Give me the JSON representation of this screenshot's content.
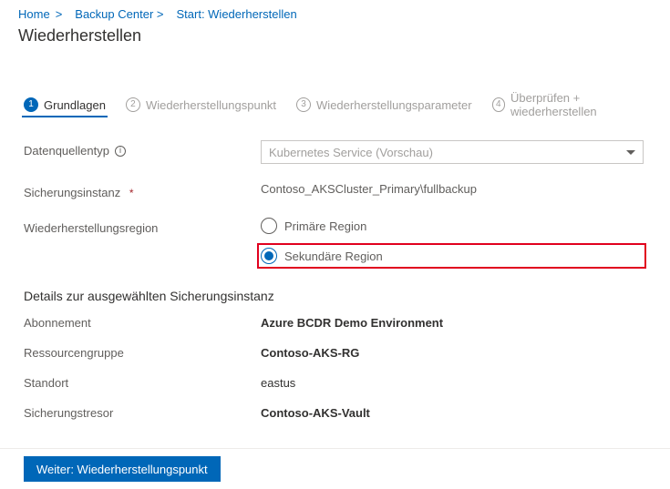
{
  "breadcrumb": {
    "home": "Home",
    "sep1": ">",
    "center": "Backup Center >",
    "start": "Start: Wiederherstellen"
  },
  "title": "Wiederherstellen",
  "wizard": {
    "step1": "Grundlagen",
    "step2": "Wiederherstellungspunkt",
    "step3": "Wiederherstellungsparameter",
    "step4": "Überprüfen + wiederherstellen"
  },
  "form": {
    "datasource_label": "Datenquellentyp",
    "datasource_value": "Kubernetes Service (Vorschau)",
    "instance_label": "Sicherungsinstanz",
    "instance_value": "Contoso_AKSCluster_Primary\\fullbackup",
    "region_label": "Wiederherstellungsregion",
    "region_primary": "Primäre Region",
    "region_secondary": "Sekundäre Region"
  },
  "details": {
    "heading": "Details zur ausgewählten Sicherungsinstanz",
    "subscription_l": "Abonnement",
    "subscription_v": "Azure BCDR Demo Environment",
    "rg_l": "Ressourcengruppe",
    "rg_v": "Contoso-AKS-RG",
    "loc_l": "Standort",
    "loc_v": "eastus",
    "vault_l": "Sicherungstresor",
    "vault_v": "Contoso-AKS-Vault"
  },
  "footer": {
    "next": "Weiter: Wiederherstellungspunkt"
  }
}
